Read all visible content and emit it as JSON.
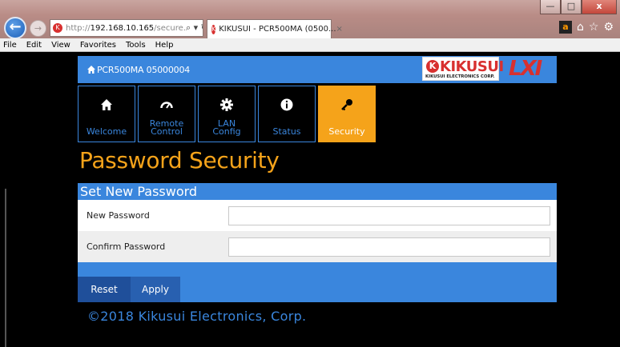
{
  "browser": {
    "address_prefix": "http://",
    "address_host": "192.168.10.165",
    "address_rest": "/secure.",
    "address_controls": "⌕ ▾ ↻",
    "tab_title": "KIKUSUI - PCR500MA (0500...",
    "tab_close": "×",
    "menu": [
      "File",
      "Edit",
      "View",
      "Favorites",
      "Tools",
      "Help"
    ],
    "window_buttons": [
      "—",
      "□",
      "x"
    ]
  },
  "header": {
    "device_name": "PCR500MA 05000004",
    "logo_text": "KIKUSUI",
    "logo_subtext": "KIKUSUI ELECTRONICS CORP.",
    "lxi_text": "LXI"
  },
  "nav": {
    "welcome": "Welcome",
    "remote_control_1": "Remote",
    "remote_control_2": "Control",
    "lan_config_1": "LAN",
    "lan_config_2": "Config",
    "status": "Status",
    "security": "Security"
  },
  "main": {
    "title": "Password Security",
    "panel_title": "Set New Password",
    "new_password_label": "New Password",
    "new_password_value": "",
    "confirm_password_label": "Confirm Password",
    "confirm_password_value": "",
    "reset_label": "Reset",
    "apply_label": "Apply",
    "copyright": "©2018 Kikusui Electronics, Corp."
  },
  "colors": {
    "accent_blue": "#3a86dd",
    "accent_orange": "#f5a31a",
    "brand_red": "#d8302f"
  }
}
